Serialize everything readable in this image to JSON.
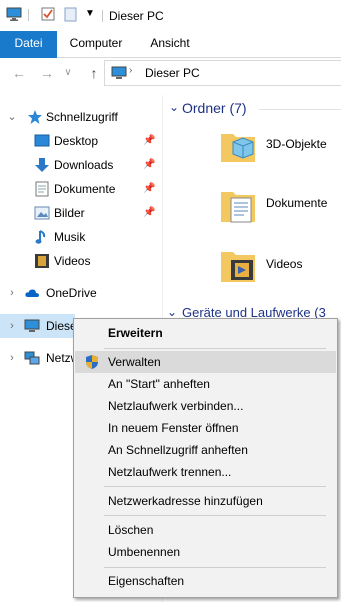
{
  "titlebar": {
    "title": "Dieser PC"
  },
  "ribbon": {
    "tabs": [
      "Datei",
      "Computer",
      "Ansicht"
    ]
  },
  "address": {
    "path": "Dieser PC"
  },
  "nav": {
    "back": "←",
    "forward": "→",
    "dropdown": "∨",
    "up": "↑"
  },
  "sidebar": {
    "quick_access": "Schnellzugriff",
    "quick_items": [
      "Desktop",
      "Downloads",
      "Dokumente",
      "Bilder",
      "Musik",
      "Videos"
    ],
    "onedrive": "OneDrive",
    "this_pc": "Dieser",
    "network": "Netzw"
  },
  "content": {
    "folders_header": "Ordner (7)",
    "folders": [
      "3D-Objekte",
      "Dokumente",
      "Videos"
    ],
    "drives_header": "Geräte und Laufwerke (3"
  },
  "context_menu": {
    "items": [
      "Erweitern",
      "Verwalten",
      "An \"Start\" anheften",
      "Netzlaufwerk verbinden...",
      "In neuem Fenster öffnen",
      "An Schnellzugriff anheften",
      "Netzlaufwerk trennen...",
      "Netzwerkadresse hinzufügen",
      "Löschen",
      "Umbenennen",
      "Eigenschaften"
    ]
  },
  "colors": {
    "accent": "#1979ca",
    "group_header": "#1e3287",
    "folder": "#f4c860",
    "menu_bg": "#f2f2f2"
  }
}
